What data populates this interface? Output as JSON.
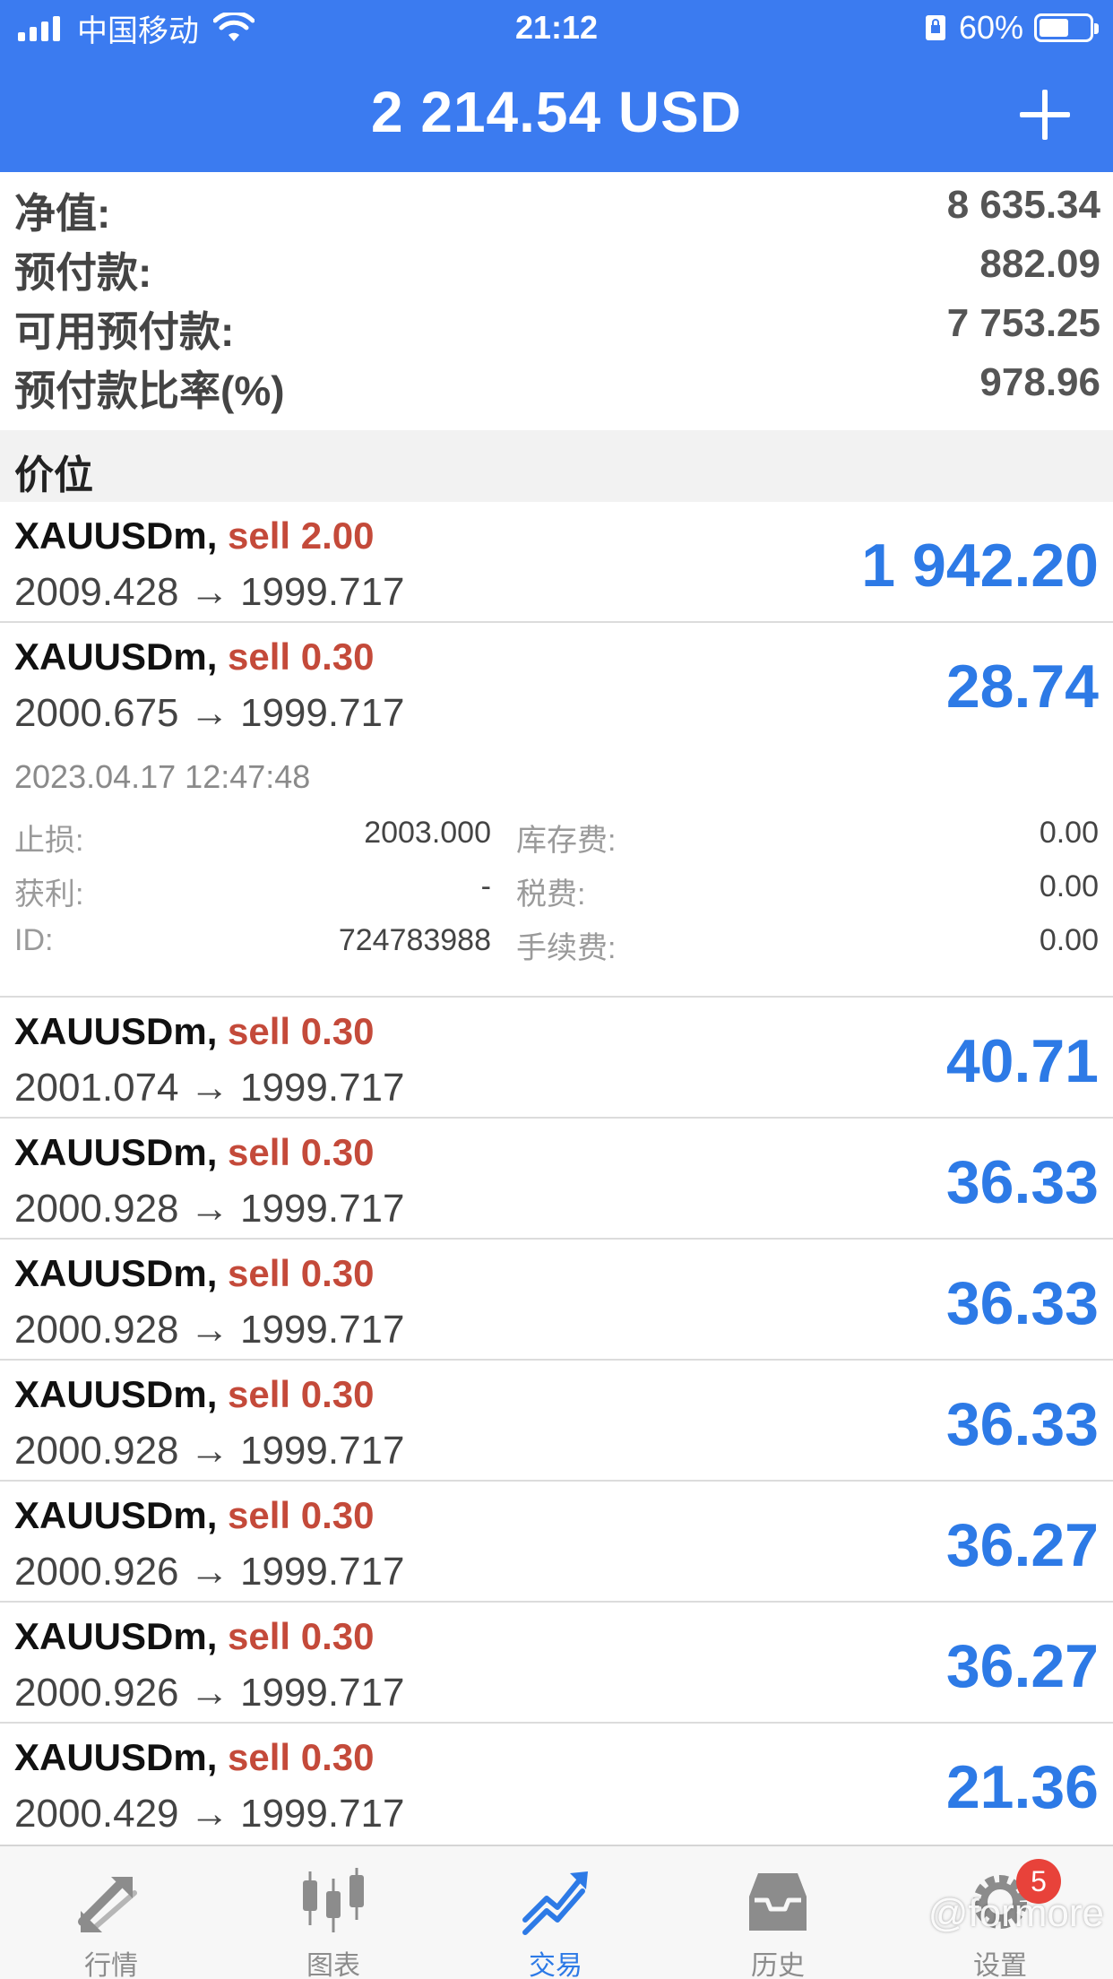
{
  "status_bar": {
    "carrier": "中国移动",
    "time": "21:12",
    "battery": "60%",
    "battery_level": 0.6
  },
  "header": {
    "balance": "2 214.54 USD"
  },
  "summary": [
    {
      "label": "净值:",
      "value": "8 635.34"
    },
    {
      "label": "预付款:",
      "value": "882.09"
    },
    {
      "label": "可用预付款:",
      "value": "7 753.25"
    },
    {
      "label": "预付款比率(%)",
      "value": "978.96"
    }
  ],
  "section": {
    "title": "价位"
  },
  "positions_top": [
    {
      "symbol": "XAUUSDm,",
      "side": "sell 2.00",
      "prices": "2009.428 → 1999.717",
      "profit": "1 942.20"
    },
    {
      "symbol": "XAUUSDm,",
      "side": "sell 0.30",
      "prices": "2000.675 → 1999.717",
      "profit": "28.74"
    }
  ],
  "detail": {
    "time": "2023.04.17 12:47:48",
    "stop_loss_label": "止损:",
    "stop_loss": "2003.000",
    "take_profit_label": "获利:",
    "take_profit": "-",
    "id_label": "ID:",
    "id": "724783988",
    "swap_label": "库存费:",
    "swap": "0.00",
    "tax_label": "税费:",
    "tax": "0.00",
    "commission_label": "手续费:",
    "commission": "0.00"
  },
  "positions_bottom": [
    {
      "symbol": "XAUUSDm,",
      "side": "sell 0.30",
      "prices": "2001.074 → 1999.717",
      "profit": "40.71"
    },
    {
      "symbol": "XAUUSDm,",
      "side": "sell 0.30",
      "prices": "2000.928 → 1999.717",
      "profit": "36.33"
    },
    {
      "symbol": "XAUUSDm,",
      "side": "sell 0.30",
      "prices": "2000.928 → 1999.717",
      "profit": "36.33"
    },
    {
      "symbol": "XAUUSDm,",
      "side": "sell 0.30",
      "prices": "2000.928 → 1999.717",
      "profit": "36.33"
    },
    {
      "symbol": "XAUUSDm,",
      "side": "sell 0.30",
      "prices": "2000.926 → 1999.717",
      "profit": "36.27"
    },
    {
      "symbol": "XAUUSDm,",
      "side": "sell 0.30",
      "prices": "2000.926 → 1999.717",
      "profit": "36.27"
    },
    {
      "symbol": "XAUUSDm,",
      "side": "sell 0.30",
      "prices": "2000.429 → 1999.717",
      "profit": "21.36"
    }
  ],
  "tabs": [
    {
      "label": "行情",
      "icon": "quotes-arrows-icon"
    },
    {
      "label": "图表",
      "icon": "candlestick-chart-icon"
    },
    {
      "label": "交易",
      "icon": "trade-trend-icon"
    },
    {
      "label": "历史",
      "icon": "history-tray-icon"
    },
    {
      "label": "设置",
      "icon": "gear-icon",
      "badge": "5"
    }
  ],
  "colors": {
    "header_blue": "#3b7bf0",
    "profit_blue": "#2d7ae6",
    "sell_red": "#c44a3a",
    "badge_red": "#e8423a"
  },
  "watermark": "@formore"
}
